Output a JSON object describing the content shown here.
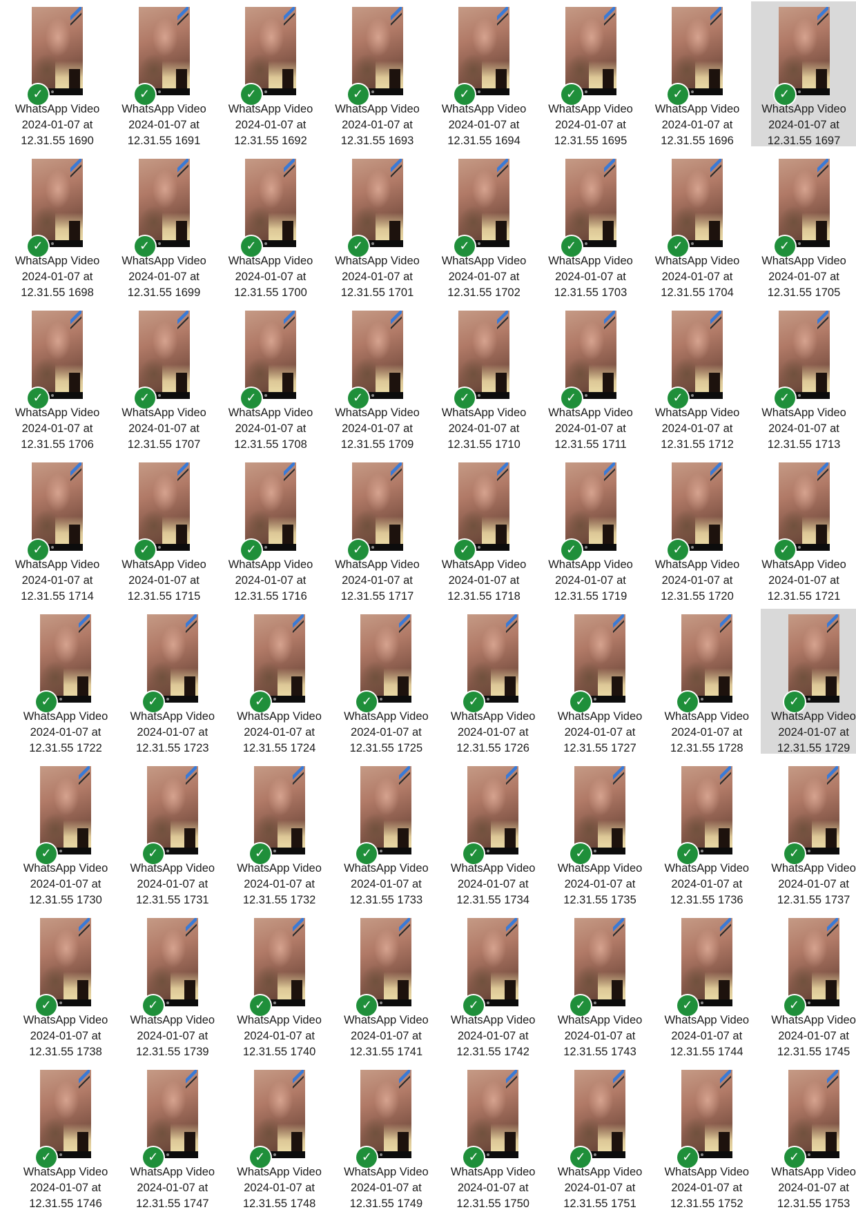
{
  "view": "file-explorer-large-icons",
  "sync_status_icon": "cloud-synced-check-icon",
  "sync_status_color": "#1f8f3a",
  "selection_color": "#d9d9d9",
  "files": [
    {
      "line1": "WhatsApp Video",
      "line2": "2024-01-07 at",
      "line3": "12.31.55 1690",
      "selected": false
    },
    {
      "line1": "WhatsApp Video",
      "line2": "2024-01-07 at",
      "line3": "12.31.55 1691",
      "selected": false
    },
    {
      "line1": "WhatsApp Video",
      "line2": "2024-01-07 at",
      "line3": "12.31.55 1692",
      "selected": false
    },
    {
      "line1": "WhatsApp Video",
      "line2": "2024-01-07 at",
      "line3": "12.31.55 1693",
      "selected": false
    },
    {
      "line1": "WhatsApp Video",
      "line2": "2024-01-07 at",
      "line3": "12.31.55 1694",
      "selected": false
    },
    {
      "line1": "WhatsApp Video",
      "line2": "2024-01-07 at",
      "line3": "12.31.55 1695",
      "selected": false
    },
    {
      "line1": "WhatsApp Video",
      "line2": "2024-01-07 at",
      "line3": "12.31.55 1696",
      "selected": false
    },
    {
      "line1": "WhatsApp Video",
      "line2": "2024-01-07 at",
      "line3": "12.31.55 1697",
      "selected": true
    },
    {
      "line1": "WhatsApp Video",
      "line2": "2024-01-07 at",
      "line3": "12.31.55 1698",
      "selected": false
    },
    {
      "line1": "WhatsApp Video",
      "line2": "2024-01-07 at",
      "line3": "12.31.55 1699",
      "selected": false
    },
    {
      "line1": "WhatsApp Video",
      "line2": "2024-01-07 at",
      "line3": "12.31.55 1700",
      "selected": false
    },
    {
      "line1": "WhatsApp Video",
      "line2": "2024-01-07 at",
      "line3": "12.31.55 1701",
      "selected": false
    },
    {
      "line1": "WhatsApp Video",
      "line2": "2024-01-07 at",
      "line3": "12.31.55 1702",
      "selected": false
    },
    {
      "line1": "WhatsApp Video",
      "line2": "2024-01-07 at",
      "line3": "12.31.55 1703",
      "selected": false
    },
    {
      "line1": "WhatsApp Video",
      "line2": "2024-01-07 at",
      "line3": "12.31.55 1704",
      "selected": false
    },
    {
      "line1": "WhatsApp Video",
      "line2": "2024-01-07 at",
      "line3": "12.31.55 1705",
      "selected": false
    },
    {
      "line1": "WhatsApp Video",
      "line2": "2024-01-07 at",
      "line3": "12.31.55 1706",
      "selected": false
    },
    {
      "line1": "WhatsApp Video",
      "line2": "2024-01-07 at",
      "line3": "12.31.55 1707",
      "selected": false
    },
    {
      "line1": "WhatsApp Video",
      "line2": "2024-01-07 at",
      "line3": "12.31.55 1708",
      "selected": false
    },
    {
      "line1": "WhatsApp Video",
      "line2": "2024-01-07 at",
      "line3": "12.31.55 1709",
      "selected": false
    },
    {
      "line1": "WhatsApp Video",
      "line2": "2024-01-07 at",
      "line3": "12.31.55 1710",
      "selected": false
    },
    {
      "line1": "WhatsApp Video",
      "line2": "2024-01-07 at",
      "line3": "12.31.55 1711",
      "selected": false
    },
    {
      "line1": "WhatsApp Video",
      "line2": "2024-01-07 at",
      "line3": "12.31.55 1712",
      "selected": false
    },
    {
      "line1": "WhatsApp Video",
      "line2": "2024-01-07 at",
      "line3": "12.31.55 1713",
      "selected": false
    },
    {
      "line1": "WhatsApp Video",
      "line2": "2024-01-07 at",
      "line3": "12.31.55 1714",
      "selected": false
    },
    {
      "line1": "WhatsApp Video",
      "line2": "2024-01-07 at",
      "line3": "12.31.55 1715",
      "selected": false
    },
    {
      "line1": "WhatsApp Video",
      "line2": "2024-01-07 at",
      "line3": "12.31.55 1716",
      "selected": false
    },
    {
      "line1": "WhatsApp Video",
      "line2": "2024-01-07 at",
      "line3": "12.31.55 1717",
      "selected": false
    },
    {
      "line1": "WhatsApp Video",
      "line2": "2024-01-07 at",
      "line3": "12.31.55 1718",
      "selected": false
    },
    {
      "line1": "WhatsApp Video",
      "line2": "2024-01-07 at",
      "line3": "12.31.55 1719",
      "selected": false
    },
    {
      "line1": "WhatsApp Video",
      "line2": "2024-01-07 at",
      "line3": "12.31.55 1720",
      "selected": false
    },
    {
      "line1": "WhatsApp Video",
      "line2": "2024-01-07 at",
      "line3": "12.31.55 1721",
      "selected": false
    },
    {
      "line1": "WhatsApp Video",
      "line2": "2024-01-07 at",
      "line3": "12.31.55 1722",
      "selected": false
    },
    {
      "line1": "WhatsApp Video",
      "line2": "2024-01-07 at",
      "line3": "12.31.55 1723",
      "selected": false
    },
    {
      "line1": "WhatsApp Video",
      "line2": "2024-01-07 at",
      "line3": "12.31.55 1724",
      "selected": false
    },
    {
      "line1": "WhatsApp Video",
      "line2": "2024-01-07 at",
      "line3": "12.31.55 1725",
      "selected": false
    },
    {
      "line1": "WhatsApp Video",
      "line2": "2024-01-07 at",
      "line3": "12.31.55 1726",
      "selected": false
    },
    {
      "line1": "WhatsApp Video",
      "line2": "2024-01-07 at",
      "line3": "12.31.55 1727",
      "selected": false
    },
    {
      "line1": "WhatsApp Video",
      "line2": "2024-01-07 at",
      "line3": "12.31.55 1728",
      "selected": false
    },
    {
      "line1": "WhatsApp Video",
      "line2": "2024-01-07 at",
      "line3": "12.31.55 1729",
      "selected": true
    },
    {
      "line1": "WhatsApp Video",
      "line2": "2024-01-07 at",
      "line3": "12.31.55 1730",
      "selected": false
    },
    {
      "line1": "WhatsApp Video",
      "line2": "2024-01-07 at",
      "line3": "12.31.55 1731",
      "selected": false
    },
    {
      "line1": "WhatsApp Video",
      "line2": "2024-01-07 at",
      "line3": "12.31.55 1732",
      "selected": false
    },
    {
      "line1": "WhatsApp Video",
      "line2": "2024-01-07 at",
      "line3": "12.31.55 1733",
      "selected": false
    },
    {
      "line1": "WhatsApp Video",
      "line2": "2024-01-07 at",
      "line3": "12.31.55 1734",
      "selected": false
    },
    {
      "line1": "WhatsApp Video",
      "line2": "2024-01-07 at",
      "line3": "12.31.55 1735",
      "selected": false
    },
    {
      "line1": "WhatsApp Video",
      "line2": "2024-01-07 at",
      "line3": "12.31.55 1736",
      "selected": false
    },
    {
      "line1": "WhatsApp Video",
      "line2": "2024-01-07 at",
      "line3": "12.31.55 1737",
      "selected": false
    },
    {
      "line1": "WhatsApp Video",
      "line2": "2024-01-07 at",
      "line3": "12.31.55 1738",
      "selected": false
    },
    {
      "line1": "WhatsApp Video",
      "line2": "2024-01-07 at",
      "line3": "12.31.55 1739",
      "selected": false
    },
    {
      "line1": "WhatsApp Video",
      "line2": "2024-01-07 at",
      "line3": "12.31.55 1740",
      "selected": false
    },
    {
      "line1": "WhatsApp Video",
      "line2": "2024-01-07 at",
      "line3": "12.31.55 1741",
      "selected": false
    },
    {
      "line1": "WhatsApp Video",
      "line2": "2024-01-07 at",
      "line3": "12.31.55 1742",
      "selected": false
    },
    {
      "line1": "WhatsApp Video",
      "line2": "2024-01-07 at",
      "line3": "12.31.55 1743",
      "selected": false
    },
    {
      "line1": "WhatsApp Video",
      "line2": "2024-01-07 at",
      "line3": "12.31.55 1744",
      "selected": false
    },
    {
      "line1": "WhatsApp Video",
      "line2": "2024-01-07 at",
      "line3": "12.31.55 1745",
      "selected": false
    },
    {
      "line1": "WhatsApp Video",
      "line2": "2024-01-07 at",
      "line3": "12.31.55 1746",
      "selected": false
    },
    {
      "line1": "WhatsApp Video",
      "line2": "2024-01-07 at",
      "line3": "12.31.55 1747",
      "selected": false
    },
    {
      "line1": "WhatsApp Video",
      "line2": "2024-01-07 at",
      "line3": "12.31.55 1748",
      "selected": false
    },
    {
      "line1": "WhatsApp Video",
      "line2": "2024-01-07 at",
      "line3": "12.31.55 1749",
      "selected": false
    },
    {
      "line1": "WhatsApp Video",
      "line2": "2024-01-07 at",
      "line3": "12.31.55 1750",
      "selected": false
    },
    {
      "line1": "WhatsApp Video",
      "line2": "2024-01-07 at",
      "line3": "12.31.55 1751",
      "selected": false
    },
    {
      "line1": "WhatsApp Video",
      "line2": "2024-01-07 at",
      "line3": "12.31.55 1752",
      "selected": false
    },
    {
      "line1": "WhatsApp Video",
      "line2": "2024-01-07 at",
      "line3": "12.31.55 1753",
      "selected": false
    }
  ]
}
